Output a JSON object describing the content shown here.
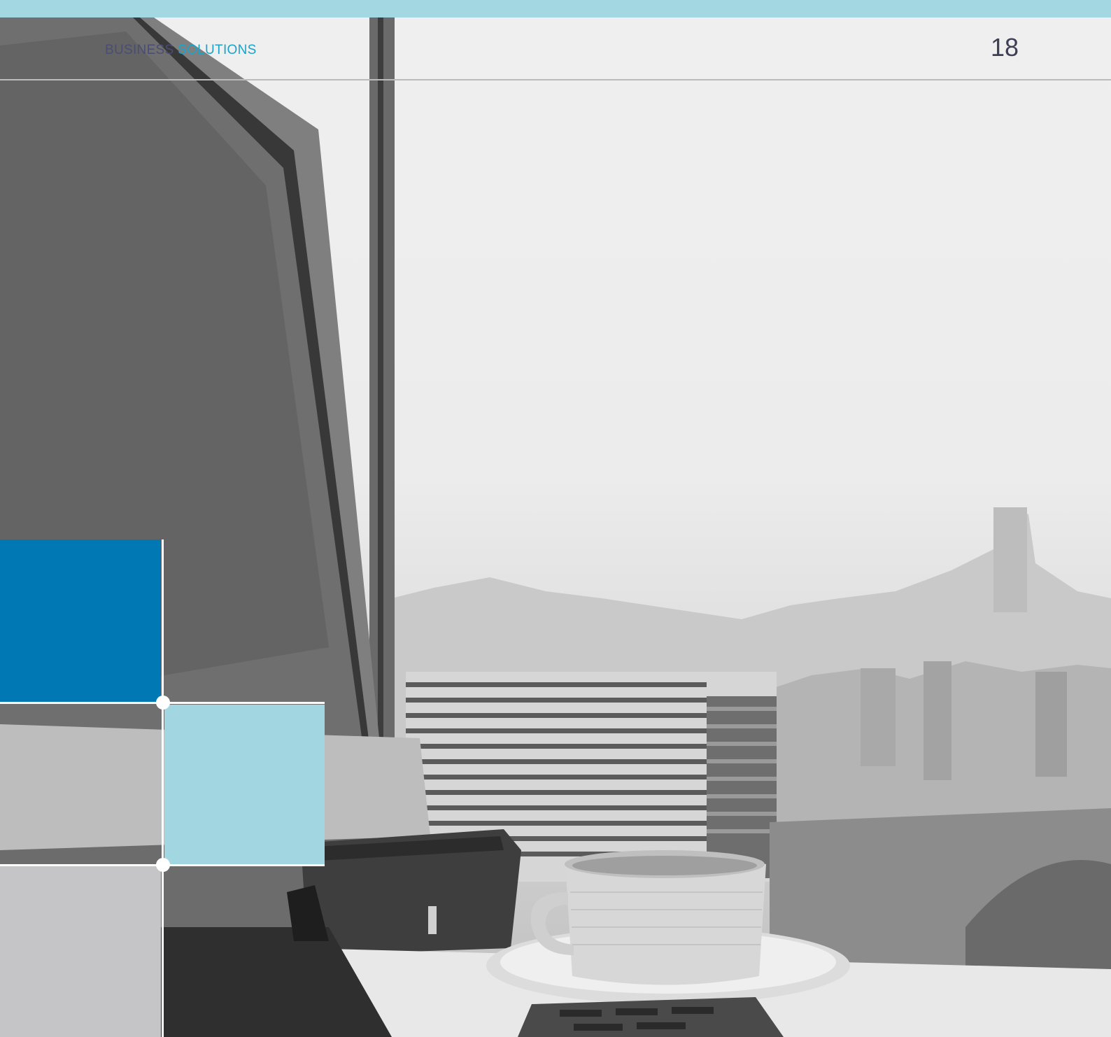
{
  "header": {
    "label_part1": "BUSINESS",
    "label_part2": "SOLUTIONS",
    "page_number": "18"
  },
  "colors": {
    "top_bar": "#a3d7e2",
    "accent_text": "#1aa3c9",
    "header_text": "#4a4d72",
    "block_dark_blue": "#0078b4",
    "block_light_blue": "#a2d7e2",
    "block_gray": "#c5c5c7"
  },
  "photo": {
    "subject": "grayscale office photo: computer monitor, coffee cup on saucer, keyboard, city skyline through window"
  }
}
